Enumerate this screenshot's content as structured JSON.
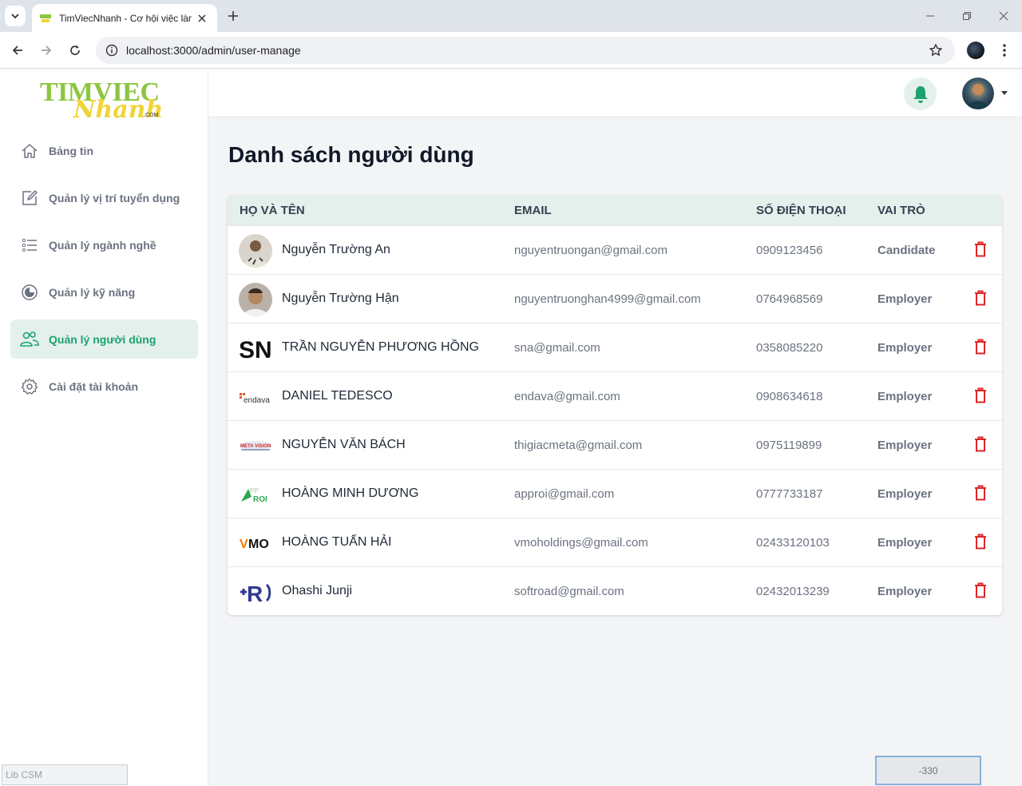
{
  "browser": {
    "tab_title": "TimViecNhanh - Cơ hội việc làm",
    "url": "localhost:3000/admin/user-manage"
  },
  "sidebar": {
    "logo_top": "TIMVIEC",
    "logo_script": "Nhanh",
    "logo_com": ".COM",
    "items": [
      {
        "label": "Bảng tin",
        "icon": "home-icon"
      },
      {
        "label": "Quản lý vị trí tuyển dụng",
        "icon": "edit-icon"
      },
      {
        "label": "Quản lý ngành nghề",
        "icon": "list-icon"
      },
      {
        "label": "Quản lý kỹ năng",
        "icon": "pie-chart-icon"
      },
      {
        "label": "Quản lý người dùng",
        "icon": "users-icon",
        "active": true
      },
      {
        "label": "Cài đặt tài khoản",
        "icon": "gear-icon"
      }
    ],
    "footer_input": "Lib CSM"
  },
  "main": {
    "title": "Danh sách người dùng",
    "columns": [
      "HỌ VÀ TÊN",
      "EMAIL",
      "SỐ ĐIỆN THOẠI",
      "VAI TRÒ"
    ],
    "rows": [
      {
        "name": "Nguyễn Trường An",
        "email": "nguyentruongan@gmail.com",
        "phone": "0909123456",
        "role": "Candidate",
        "logo": "person-photo"
      },
      {
        "name": "Nguyễn Trường Hận",
        "email": "nguyentruonghan4999@gmail.com",
        "phone": "0764968569",
        "role": "Employer",
        "logo": "person-photo"
      },
      {
        "name": "TRẦN NGUYỄN PHƯƠNG HỒNG",
        "email": "sna@gmail.com",
        "phone": "0358085220",
        "role": "Employer",
        "logo": "SN"
      },
      {
        "name": "DANIEL TEDESCO",
        "email": "endava@gmail.com",
        "phone": "0908634618",
        "role": "Employer",
        "logo": "endava"
      },
      {
        "name": "NGUYỄN VĂN BÁCH",
        "email": "thigiacmeta@gmail.com",
        "phone": "0975119899",
        "role": "Employer",
        "logo": "META VISION"
      },
      {
        "name": "HOÀNG MINH DƯƠNG",
        "email": "approi@gmail.com",
        "phone": "0777733187",
        "role": "Employer",
        "logo": "ROI"
      },
      {
        "name": "HOÀNG TUẤN HẢI",
        "email": "vmoholdings@gmail.com",
        "phone": "02433120103",
        "role": "Employer",
        "logo": "VMO"
      },
      {
        "name": "Ohashi Junji",
        "email": "softroad@gmail.com",
        "phone": "02432013239",
        "role": "Employer",
        "logo": "R"
      }
    ]
  },
  "overlay": {
    "value": "-330"
  },
  "colors": {
    "accent": "#1aa36f",
    "delete": "#dc2626",
    "header_bg": "#e5efec"
  }
}
